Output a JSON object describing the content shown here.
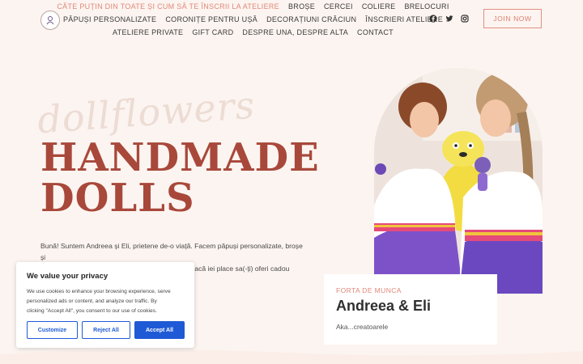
{
  "nav": {
    "row1": [
      "Câte puțin din toate și cum să te înscrii la ateliere",
      "Broșe",
      "Cercei",
      "Coliere",
      "Brelocuri"
    ],
    "row2": [
      "Păpuși personalizate",
      "Coronițe pentru ușă",
      "Decorațiuni Crăciun",
      "Înscrieri ateliere"
    ],
    "row3": [
      "Ateliere private",
      "Gift Card",
      "Despre una, despre alta",
      "Contact"
    ]
  },
  "header": {
    "join_label": "JOIN NOW"
  },
  "social": [
    "facebook-icon",
    "twitter-icon",
    "instagram-icon"
  ],
  "hero": {
    "script_text": "dollflowers",
    "headline_line1": "HANDMADE",
    "headline_line2": "DOLLS",
    "intro_line1": "Bună! Suntem Andreea și Eli, prietene de-o viață. Facem păpuși personalizate, broșe și",
    "intro_line2": "alte nebunii numa' bune de oferit cadou. Așa ca, dacă iei place sa(-ți) oferi cadou"
  },
  "card": {
    "kicker": "FORTA DE MUNCA",
    "title": "Andreea & Eli",
    "subtitle": "Aka...creatoarele"
  },
  "cookie": {
    "title": "We value your privacy",
    "text_line1": "We use cookies to enhance your browsing experience, serve",
    "text_line2": "personalized ads or content, and analyze our traffic. By",
    "text_line3": "clicking \"Accept All\", you consent to our use of cookies.",
    "customize": "Customize",
    "reject": "Reject All",
    "accept": "Accept All"
  },
  "colors": {
    "accent": "#e0887a",
    "headline": "#a8483b",
    "button_blue": "#1f5ad6",
    "background": "#fcf4f0"
  }
}
